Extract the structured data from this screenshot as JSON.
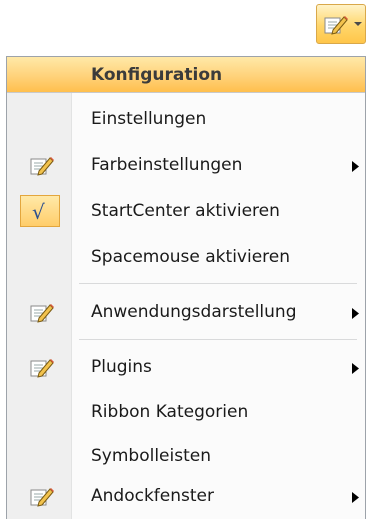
{
  "toolbar": {
    "icon": "edit-icon",
    "dropdown": "chevron-down-icon"
  },
  "menu": {
    "header": "Konfiguration",
    "items": [
      {
        "label": "Einstellungen"
      },
      {
        "label": "Farbeinstellungen",
        "icon": "edit-icon",
        "submenu": true
      },
      {
        "label": "StartCenter aktivieren",
        "checked": true,
        "check_glyph": "√"
      },
      {
        "label": "Spacemouse aktivieren"
      },
      {
        "label": "Anwendungsdarstellung",
        "icon": "edit-icon",
        "submenu": true
      },
      {
        "label": "Plugins",
        "icon": "edit-icon",
        "submenu": true
      },
      {
        "label": "Ribbon Kategorien"
      },
      {
        "label": "Symbolleisten"
      },
      {
        "label": "Andockfenster",
        "icon": "edit-icon",
        "submenu": true
      }
    ]
  },
  "colors": {
    "highlight": "#ffd27a",
    "check": "#2b4f8f"
  }
}
